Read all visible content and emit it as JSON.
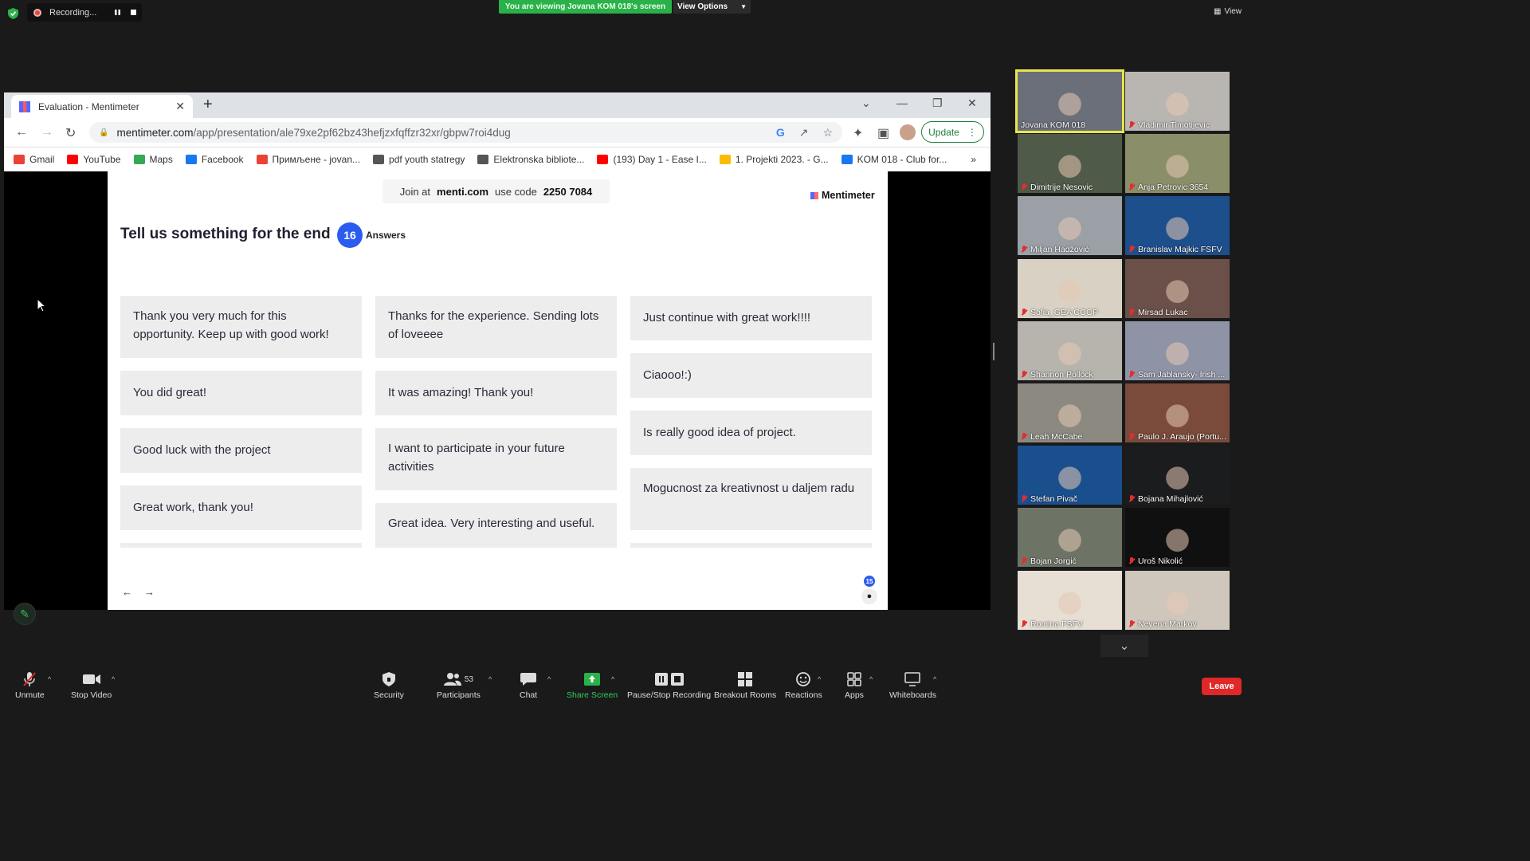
{
  "meeting": {
    "recording_label": "Recording...",
    "share_banner": "You are viewing Jovana KOM 018's screen",
    "view_options": "View Options",
    "view_label": "View"
  },
  "browser": {
    "tab_title": "Evaluation - Mentimeter",
    "url_host": "mentimeter.com",
    "url_path": "/app/presentation/ale79xe2pf62bz43hefjzxfqffzr32xr/gbpw7roi4dug",
    "update_label": "Update",
    "bookmarks": [
      {
        "label": "Gmail",
        "icon": "gmail-icon",
        "color": "#ea4335"
      },
      {
        "label": "YouTube",
        "icon": "youtube-icon",
        "color": "#ff0000"
      },
      {
        "label": "Maps",
        "icon": "maps-icon",
        "color": "#34a853"
      },
      {
        "label": "Facebook",
        "icon": "facebook-icon",
        "color": "#1877f2"
      },
      {
        "label": "Примљене - jovan...",
        "icon": "gmail-icon",
        "color": "#ea4335"
      },
      {
        "label": "pdf youth statregy",
        "icon": "globe-icon",
        "color": "#555555"
      },
      {
        "label": "Elektronska bibliote...",
        "icon": "v-icon",
        "color": "#555555"
      },
      {
        "label": "(193) Day 1 - Ease I...",
        "icon": "youtube-icon",
        "color": "#ff0000"
      },
      {
        "label": "1. Projekti 2023. - G...",
        "icon": "drive-icon",
        "color": "#fbbc04"
      },
      {
        "label": "KOM 018 - Club for...",
        "icon": "facebook-icon",
        "color": "#1877f2"
      }
    ],
    "more_bookmarks": "»"
  },
  "slide": {
    "join_prefix": "Join at",
    "join_site": "menti.com",
    "join_mid": "use code",
    "join_code": "2250 7084",
    "brand": "Mentimeter",
    "question": "Tell us something for the end",
    "answers_count": "16",
    "answers_label": "Answers",
    "participants_count": "15",
    "columns": [
      [
        {
          "text": "Thank you very much for this opportunity. Keep up with good work!"
        },
        {
          "text": "You did great!"
        },
        {
          "text": "Good luck with the project"
        },
        {
          "text": "Great work, thank you!"
        },
        {
          "text": ""
        }
      ],
      [
        {
          "text": "Thanks for the experience. Sending lots of loveeee"
        },
        {
          "text": "It was amazing! Thank you!"
        },
        {
          "text": "I want to participate in your future activities"
        },
        {
          "text": "Great idea. Very interesting and useful."
        }
      ],
      [
        {
          "text": "Just continue with great work!!!!"
        },
        {
          "text": "Ciaooo!:)"
        },
        {
          "text": "Is really good idea of project."
        },
        {
          "text": "Mogucnost za kreativnost u daljem radu"
        },
        {
          "text": ""
        }
      ]
    ]
  },
  "participants": [
    {
      "name": "Jovana KOM 018",
      "bg": "#6b6f7a",
      "active": true
    },
    {
      "name": "Vladimir Timotijevic",
      "bg": "#b9b6b2"
    },
    {
      "name": "Dimitrije Nesovic",
      "bg": "#4f5a48"
    },
    {
      "name": "Anja Petrovic 3654",
      "bg": "#8a8f6a"
    },
    {
      "name": "Miljan Hadžović",
      "bg": "#9aa0a6"
    },
    {
      "name": "Branislav Majkic FSFV",
      "bg": "#1d4f8c"
    },
    {
      "name": "Sofia_GEA COOP",
      "bg": "#d9d2c4"
    },
    {
      "name": "Mirsad Lukac",
      "bg": "#6a5048"
    },
    {
      "name": "Shannon Pollock",
      "bg": "#b7b4ae"
    },
    {
      "name": "Sam Jablansky- Irish ...",
      "bg": "#8f93a6"
    },
    {
      "name": "Leah McCabe",
      "bg": "#8c8a80"
    },
    {
      "name": "Paulo J. Araujo (Portu...",
      "bg": "#7a4a3a"
    },
    {
      "name": "Stefan Pivač",
      "bg": "#1a4f8e"
    },
    {
      "name": "Bojana Mihajlović",
      "bg": "#1b1c1e"
    },
    {
      "name": "Bojan Jorgić",
      "bg": "#6d7466"
    },
    {
      "name": "Uroš Nikolić",
      "bg": "#101010"
    },
    {
      "name": "Romina FSFV",
      "bg": "#e7dfd3"
    },
    {
      "name": "Nevena Markov",
      "bg": "#cfc6bc"
    }
  ],
  "toolbar": {
    "unmute": "Unmute",
    "stop_video": "Stop Video",
    "security": "Security",
    "participants": "Participants",
    "participants_count": "53",
    "chat": "Chat",
    "share_screen": "Share Screen",
    "pause_stop": "Pause/Stop Recording",
    "breakout": "Breakout Rooms",
    "reactions": "Reactions",
    "apps": "Apps",
    "whiteboards": "Whiteboards",
    "leave": "Leave"
  },
  "colors": {
    "share_green": "#2bb14a",
    "leave_red": "#e02828",
    "menti_blue": "#2b5cf0",
    "active_speaker": "#e8e64a"
  }
}
